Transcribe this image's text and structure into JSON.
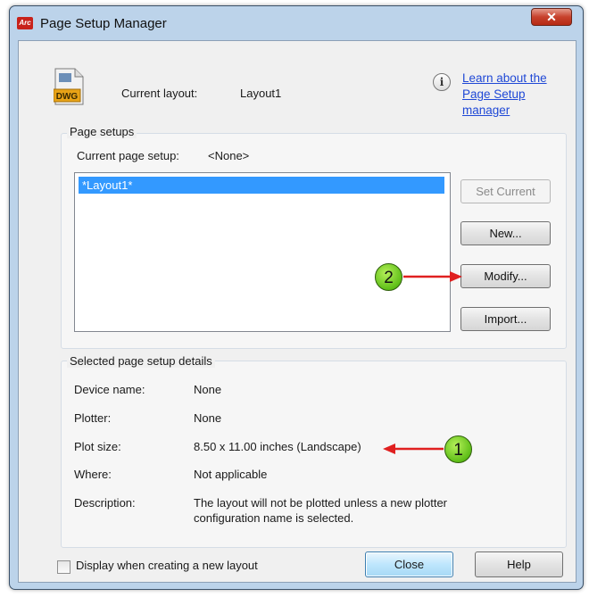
{
  "window": {
    "title": "Page Setup Manager",
    "app_icon_text": "Arc",
    "close_glyph": "✕"
  },
  "header": {
    "current_layout_label": "Current layout:",
    "current_layout_value": "Layout1",
    "info_glyph": "i",
    "learn_link_line1": "Learn about the",
    "learn_link_line2": "Page Setup manager",
    "file_icon_text": "DWG"
  },
  "page_setups": {
    "group_label": "Page setups",
    "current_setup_label": "Current page setup:",
    "current_setup_value": "<None>",
    "list_items": [
      "*Layout1*"
    ],
    "buttons": {
      "set_current": "Set Current",
      "new": "New...",
      "modify": "Modify...",
      "import": "Import..."
    }
  },
  "callouts": {
    "one": "1",
    "two": "2"
  },
  "details": {
    "group_label": "Selected page setup details",
    "device_name_label": "Device name:",
    "device_name_value": "None",
    "plotter_label": "Plotter:",
    "plotter_value": "None",
    "plot_size_label": "Plot size:",
    "plot_size_value": "8.50 x 11.00 inches (Landscape)",
    "where_label": "Where:",
    "where_value": "Not applicable",
    "description_label": "Description:",
    "description_value": "The layout will not be plotted unless a new plotter configuration name is selected."
  },
  "footer": {
    "checkbox_label": "Display when creating a new layout",
    "checkbox_checked": false,
    "close_label": "Close",
    "help_label": "Help"
  },
  "colors": {
    "selection": "#3399ff",
    "callout_green": "#5fbf18",
    "arrow_red": "#e02020",
    "link": "#1f48d6"
  }
}
